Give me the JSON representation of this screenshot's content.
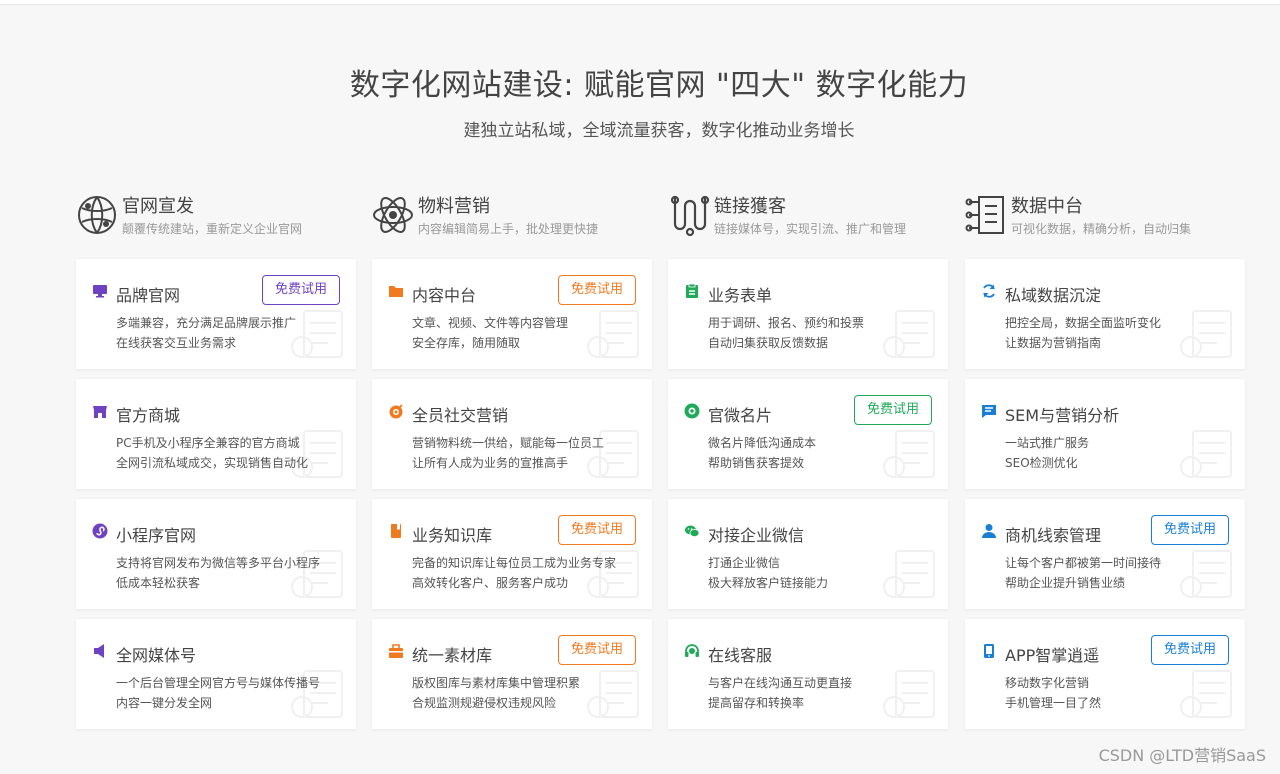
{
  "header": {
    "title": "数字化网站建设: 赋能官网 \"四大\" 数字化能力",
    "subtitle": "建独立站私域，全域流量获客，数字化推动业务增长"
  },
  "columns": [
    {
      "icon": "globe-icon",
      "title": "官网宣发",
      "desc": "颠覆传统建站，重新定义企业官网"
    },
    {
      "icon": "atom-icon",
      "title": "物料营销",
      "desc": "内容编辑简易上手，批处理更快捷"
    },
    {
      "icon": "link-chain-icon",
      "title": "链接獲客",
      "desc": "链接媒体号，实现引流、推广和管理"
    },
    {
      "icon": "data-panel-icon",
      "title": "数据中台",
      "desc": "可视化数据，精确分析，自动归集"
    }
  ],
  "cards": [
    [
      {
        "icon": "monitor-icon",
        "color": "#6f42c1",
        "title": "品牌官网",
        "lines": [
          "多端兼容，充分满足品牌展示推广",
          "在线获客交互业务需求"
        ],
        "trial": "免费试用"
      },
      {
        "icon": "shop-icon",
        "color": "#6f42c1",
        "title": "官方商城",
        "lines": [
          "PC手机及小程序全兼容的官方商城",
          "全网引流私域成交，实现销售自动化"
        ],
        "trial": ""
      },
      {
        "icon": "miniprogram-icon",
        "color": "#6f42c1",
        "title": "小程序官网",
        "lines": [
          "支持将官网发布为微信等多平台小程序",
          "低成本轻松获客"
        ],
        "trial": ""
      },
      {
        "icon": "media-speaker-icon",
        "color": "#6f42c1",
        "title": "全网媒体号",
        "lines": [
          "一个后台管理全网官方号与媒体传播号",
          "内容一键分发全网"
        ],
        "trial": ""
      }
    ],
    [
      {
        "icon": "folder-icon",
        "color": "#f07a1f",
        "title": "内容中台",
        "lines": [
          "文章、视频、文件等内容管理",
          "安全存库，随用随取"
        ],
        "trial": "免费试用"
      },
      {
        "icon": "target-icon",
        "color": "#f07a1f",
        "title": "全员社交营销",
        "lines": [
          "营销物料统一供给，赋能每一位员工",
          "让所有人成为业务的宣推高手"
        ],
        "trial": ""
      },
      {
        "icon": "book-icon",
        "color": "#f07a1f",
        "title": "业务知识库",
        "lines": [
          "完备的知识库让每位员工成为业务专家",
          "高效转化客户、服务客户成功"
        ],
        "trial": "免费试用"
      },
      {
        "icon": "toolbox-icon",
        "color": "#f07a1f",
        "title": "统一素材库",
        "lines": [
          "版权图库与素材库集中管理积累",
          "合规监测规避侵权违规风险"
        ],
        "trial": "免费试用"
      }
    ],
    [
      {
        "icon": "clipboard-icon",
        "color": "#1faa59",
        "title": "业务表单",
        "lines": [
          "用于调研、报名、预约和投票",
          "自动归集获取反馈数据"
        ],
        "trial": ""
      },
      {
        "icon": "card-icon",
        "color": "#1faa59",
        "title": "官微名片",
        "lines": [
          "微名片降低沟通成本",
          "帮助销售获客提效"
        ],
        "trial": "免费试用"
      },
      {
        "icon": "wechat-icon",
        "color": "#1faa59",
        "title": "对接企业微信",
        "lines": [
          "打通企业微信",
          "极大释放客户链接能力"
        ],
        "trial": ""
      },
      {
        "icon": "headset-icon",
        "color": "#1faa59",
        "title": "在线客服",
        "lines": [
          "与客户在线沟通互动更直接",
          "提高留存和转换率"
        ],
        "trial": ""
      }
    ],
    [
      {
        "icon": "refresh-icon",
        "color": "#1a7fd4",
        "title": "私域数据沉淀",
        "lines": [
          "把控全局，数据全面监听变化",
          "让数据为营销指南"
        ],
        "trial": ""
      },
      {
        "icon": "chat-icon",
        "color": "#1a7fd4",
        "title": "SEM与营销分析",
        "lines": [
          "一站式推广服务",
          "SEO检测优化"
        ],
        "trial": ""
      },
      {
        "icon": "user-icon",
        "color": "#1a7fd4",
        "title": "商机线索管理",
        "lines": [
          "让每个客户都被第一时间接待",
          "帮助企业提升销售业绩"
        ],
        "trial": "免费试用"
      },
      {
        "icon": "phone-icon",
        "color": "#1a7fd4",
        "title": "APP智掌逍遥",
        "lines": [
          "移动数字化营销",
          "手机管理一目了然"
        ],
        "trial": "免费试用"
      }
    ]
  ],
  "footer": {
    "watermark": "CSDN @LTD营销SaaS"
  }
}
